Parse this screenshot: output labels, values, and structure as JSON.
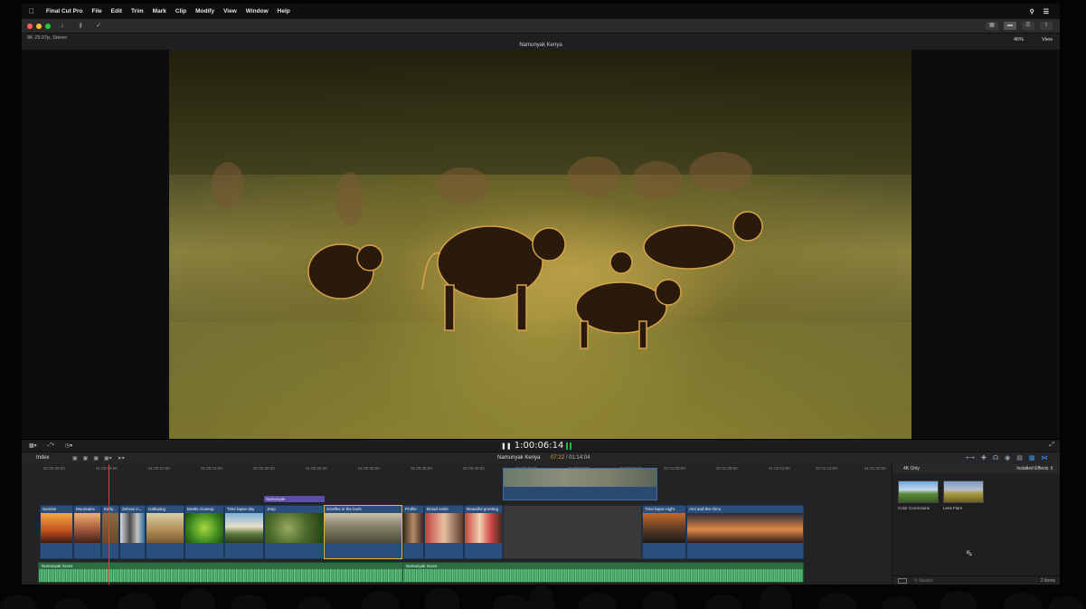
{
  "menubar": {
    "app_name": "Final Cut Pro",
    "items": [
      "File",
      "Edit",
      "Trim",
      "Mark",
      "Clip",
      "Modify",
      "View",
      "Window",
      "Help"
    ]
  },
  "viewer": {
    "format": "8K 29.97p, Stereo",
    "title": "Namunyak Kenya",
    "zoom": "46%",
    "view_menu": "View"
  },
  "transport": {
    "timecode": "1:00:06:14"
  },
  "timeline_header": {
    "index_label": "Index",
    "project_name": "Namunyak Kenya",
    "current_time": "07:22",
    "duration": "01:14:04"
  },
  "ruler": [
    "01:00:00:00",
    "01:00:05:00",
    "01:00:10:00",
    "01:00:15:00",
    "01:00:20:00",
    "01:00:25:00",
    "01:00:30:00",
    "01:00:35:00",
    "01:00:40:00",
    "01:00:45:00",
    "01:00:50:00",
    "01:00:55:00",
    "01:01:00:00",
    "01:01:05:00",
    "01:01:10:00",
    "01:01:15:00",
    "01:01:20:00"
  ],
  "connected_label": "Namunyak",
  "clips": [
    {
      "name": "Sunrise"
    },
    {
      "name": "Mountains"
    },
    {
      "name": "Early..."
    },
    {
      "name": "Zebras in..."
    },
    {
      "name": "Galloping"
    },
    {
      "name": "Beetle closeup"
    },
    {
      "name": "Time lapse day"
    },
    {
      "name": "Jeep"
    },
    {
      "name": "Giraffes in the bush"
    },
    {
      "name": "Profile"
    },
    {
      "name": "Broad smile"
    },
    {
      "name": "Beautiful greeting"
    },
    {
      "name": "Time lapse night"
    },
    {
      "name": "Ami and the rhino"
    }
  ],
  "audio": [
    {
      "name": "Namunyak Score"
    },
    {
      "name": "Namunyak Score"
    }
  ],
  "effects": {
    "filter": "4K Only",
    "category": "Installed Effects",
    "items": [
      {
        "label": "Color Corrections"
      },
      {
        "label": "Lens Flare"
      }
    ],
    "search_placeholder": "Search",
    "count": "2 items"
  }
}
